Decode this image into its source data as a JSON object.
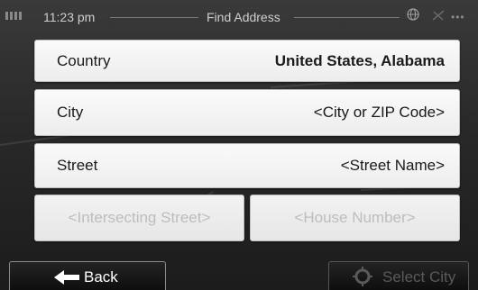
{
  "status_bar": {
    "time": "11:23 pm",
    "title": "Find Address"
  },
  "fields": [
    {
      "label": "Country",
      "value": "United States, Alabama"
    },
    {
      "label": "City",
      "value": "<City or ZIP Code>"
    },
    {
      "label": "Street",
      "value": "<Street Name>"
    }
  ],
  "disabled_fields": {
    "intersecting_street": "<Intersecting Street>",
    "house_number": "<House Number>"
  },
  "buttons": {
    "back": "Back",
    "select_city": "Select City"
  },
  "icons": {
    "battery": "battery-icon",
    "globe": "globe-icon",
    "satellite": "satellite-icon",
    "back_arrow": "arrow-left-icon",
    "select_city": "crosshair-icon"
  },
  "colors": {
    "background": "#2a2a2a",
    "field_bg": "#f2f2f2",
    "disabled_text": "#bdbdbd",
    "button_bg": "#141414"
  }
}
